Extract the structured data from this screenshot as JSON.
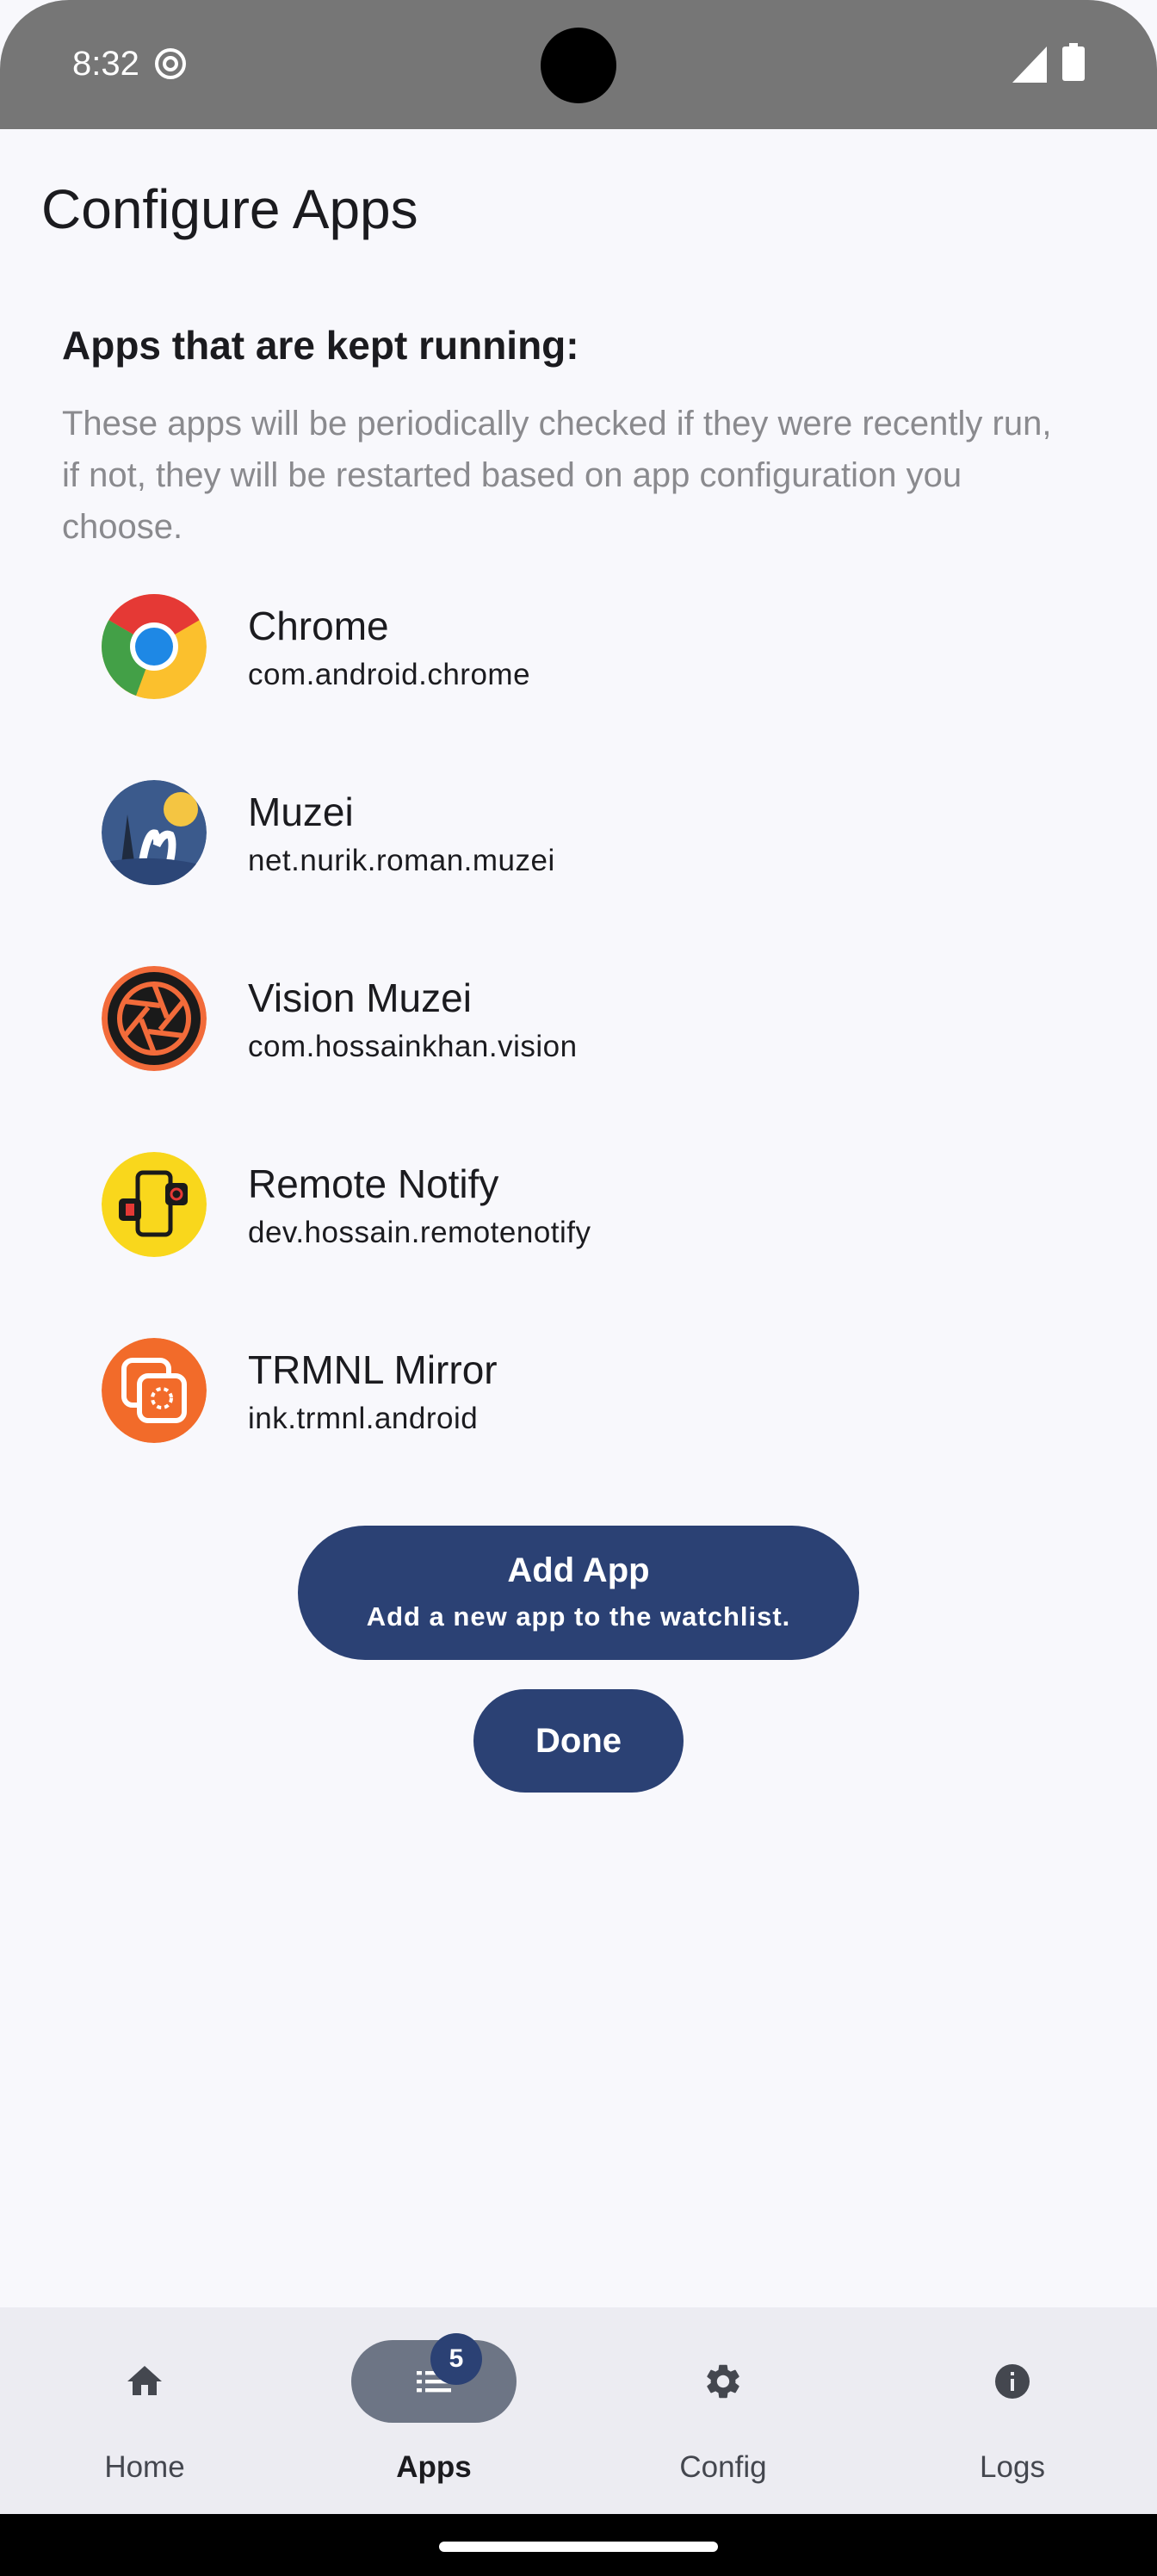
{
  "status_bar": {
    "time": "8:32"
  },
  "page": {
    "title": "Configure Apps",
    "section_title": "Apps that are kept running:",
    "description": "These apps will be periodically checked if they were recently run, if not, they will be restarted based on app configuration you choose."
  },
  "apps": [
    {
      "name": "Chrome",
      "package": "com.android.chrome",
      "icon": "chrome-icon"
    },
    {
      "name": "Muzei",
      "package": "net.nurik.roman.muzei",
      "icon": "muzei-icon"
    },
    {
      "name": "Vision Muzei",
      "package": "com.hossainkhan.vision",
      "icon": "camera-aperture-icon"
    },
    {
      "name": "Remote Notify",
      "package": "dev.hossain.remotenotify",
      "icon": "remote-notify-icon"
    },
    {
      "name": "TRMNL Mirror",
      "package": "ink.trmnl.android",
      "icon": "trmnl-icon"
    }
  ],
  "buttons": {
    "add_app_title": "Add App",
    "add_app_subtitle": "Add a new app to the watchlist.",
    "done": "Done"
  },
  "nav": {
    "items": [
      {
        "label": "Home",
        "icon": "home-icon"
      },
      {
        "label": "Apps",
        "icon": "list-icon",
        "badge": "5",
        "active": true
      },
      {
        "label": "Config",
        "icon": "gear-icon"
      },
      {
        "label": "Logs",
        "icon": "info-icon"
      }
    ]
  },
  "colors": {
    "primary": "#2b4174",
    "background": "#f8f8fc",
    "nav_background": "#ececf2",
    "status_bar": "#767676"
  }
}
